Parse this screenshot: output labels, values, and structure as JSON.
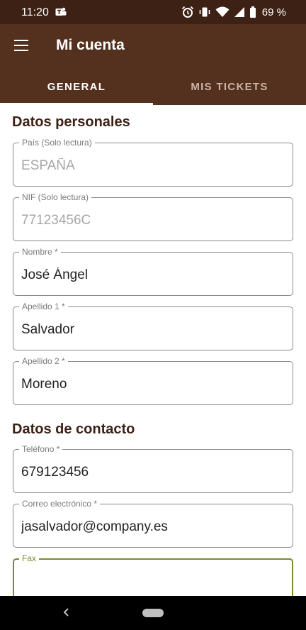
{
  "status_bar": {
    "time": "11:20",
    "battery": "69 %",
    "icons": [
      "teams-icon",
      "alarm-icon",
      "vibrate-icon",
      "wifi-icon",
      "signal-icon",
      "battery-icon"
    ]
  },
  "app_bar": {
    "title": "Mi cuenta",
    "menu_icon": "menu-icon"
  },
  "tabs": [
    {
      "label": "GENERAL",
      "selected": true
    },
    {
      "label": "MIS TICKETS",
      "selected": false
    }
  ],
  "sections": {
    "personal": {
      "title": "Datos personales",
      "fields": {
        "pais": {
          "label": "País (Solo lectura)",
          "value": "ESPAÑA",
          "readonly": true
        },
        "nif": {
          "label": "NIF (Solo lectura)",
          "value": "77123456C",
          "readonly": true
        },
        "nombre": {
          "label": "Nombre *",
          "value": "José Ángel"
        },
        "apellido1": {
          "label": "Apellido 1 *",
          "value": "Salvador"
        },
        "apellido2": {
          "label": "Apellido 2 *",
          "value": "Moreno"
        }
      }
    },
    "contact": {
      "title": "Datos de contacto",
      "fields": {
        "telefono": {
          "label": "Teléfono *",
          "value": "679123456"
        },
        "correo": {
          "label": "Correo electrónico *",
          "value": "jasalvador@company.es"
        },
        "fax": {
          "label": "Fax",
          "value": "",
          "focused": true
        }
      }
    }
  },
  "colors": {
    "status_bar": "#3d2114",
    "app_bar": "#54301f",
    "tab_inactive": "#c9b3a6",
    "section_title": "#3d2114",
    "focus_accent": "#7a8a2a",
    "nav_bar": "#000000"
  }
}
